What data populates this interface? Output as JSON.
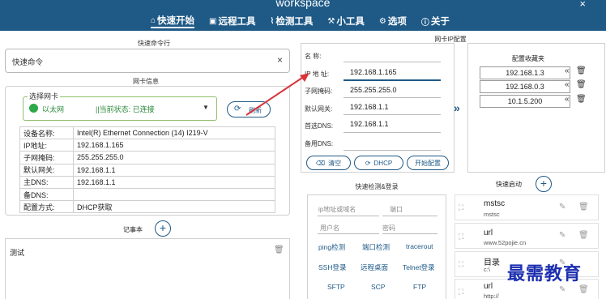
{
  "app": {
    "title": "workspace",
    "close_symbol": "×"
  },
  "nav": {
    "tabs": [
      {
        "icon": "⌂",
        "label": "快速开始"
      },
      {
        "icon": "▣",
        "label": "远程工具"
      },
      {
        "icon": "⌇",
        "label": "检测工具"
      },
      {
        "icon": "⚒",
        "label": "小工具"
      },
      {
        "icon": "⚙",
        "label": "选项"
      },
      {
        "icon": "ⓘ",
        "label": "关于"
      }
    ]
  },
  "quick_cmd": {
    "title": "快速命令行",
    "value": "快速命令",
    "clear_symbol": "×"
  },
  "nic": {
    "title": "网卡信息",
    "select_label": "选择网卡",
    "name": "以太网",
    "status": "||当前状态: 已连接",
    "refresh_label": "刷新",
    "status_color": "#2ea84a",
    "rows": [
      {
        "key": "设备名称:",
        "value": "Intel(R) Ethernet Connection (14) I219-V"
      },
      {
        "key": "IP地址:",
        "value": "192.168.1.165"
      },
      {
        "key": "子网掩码:",
        "value": "255.255.255.0"
      },
      {
        "key": "默认网关:",
        "value": "192.168.1.1"
      },
      {
        "key": "主DNS:",
        "value": "192.168.1.1"
      },
      {
        "key": "备DNS:",
        "value": ""
      },
      {
        "key": "配置方式:",
        "value": "DHCP获取"
      }
    ]
  },
  "notes": {
    "title": "记事本",
    "items": [
      {
        "text": "测试"
      }
    ]
  },
  "ipconfig": {
    "title": "网卡IP配置",
    "fields": [
      {
        "label": "名    称:",
        "value": ""
      },
      {
        "label": "IP 地 址:",
        "value": "192.168.1.165"
      },
      {
        "label": "子网掩码:",
        "value": "255.255.255.0"
      },
      {
        "label": "默认网关:",
        "value": "192.168.1.1"
      },
      {
        "label": "首选DNS:",
        "value": "192.168.1.1"
      },
      {
        "label": "备用DNS:",
        "value": ""
      }
    ],
    "buttons": {
      "clear": "清空",
      "dhcp": "DHCP",
      "apply": "开始配置"
    },
    "transfer_symbol": "»"
  },
  "favorites": {
    "title": "配置收藏夹",
    "items": [
      "192.168.1.3",
      "192.168.0.3",
      "10.1.5.200"
    ],
    "load_symbol": "«"
  },
  "detect": {
    "title": "快速检测&登录",
    "host_placeholder": "ip地址或域名",
    "port_placeholder": "端口",
    "user_placeholder": "用户名",
    "pass_placeholder": "密码",
    "links": [
      [
        "ping检测",
        "端口检测",
        "tracerout"
      ],
      [
        "SSH登录",
        "远程桌面",
        "Telnet登录"
      ],
      [
        "SFTP",
        "SCP",
        "FTP"
      ]
    ]
  },
  "launch": {
    "title": "快速启动",
    "items": [
      {
        "name": "mstsc",
        "path": "mstsc"
      },
      {
        "name": "url",
        "path": "www.52pojie.cn"
      },
      {
        "name": "目录",
        "path": "c:\\"
      },
      {
        "name": "url",
        "path": "http://"
      }
    ]
  },
  "watermark": {
    "text": "最需教育"
  },
  "colors": {
    "titlebar": "#1f5a87",
    "accent": "#1f5a87",
    "arrow": "#d9343a",
    "watermark": "#1c2fb0"
  }
}
